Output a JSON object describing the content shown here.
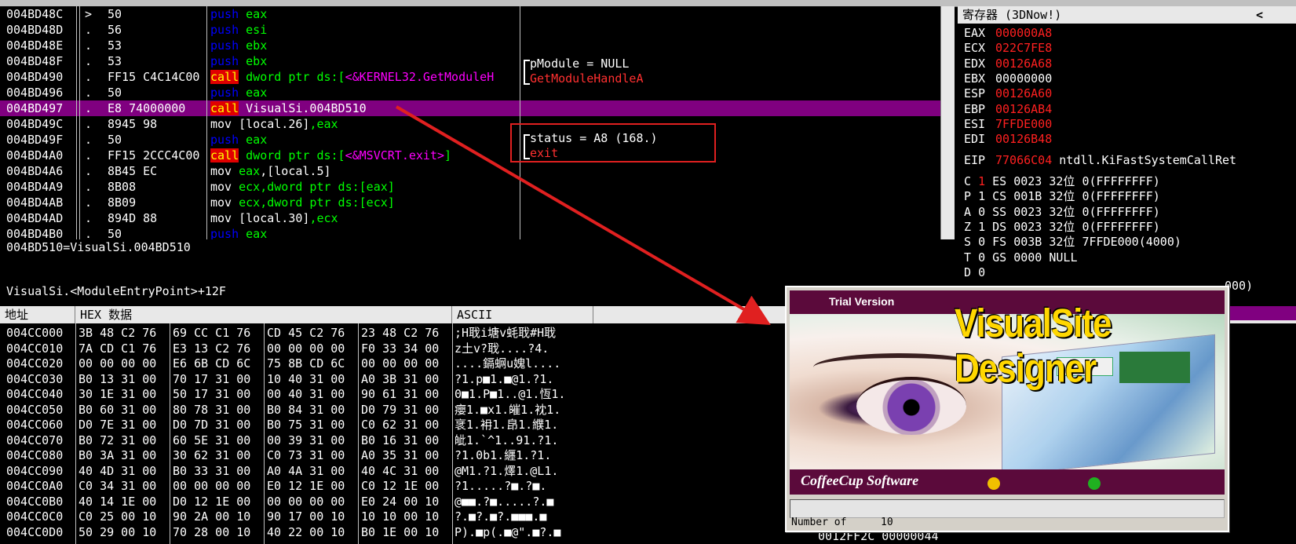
{
  "disasm": {
    "rows": [
      {
        "addr": "004BD48C",
        "mark": ">",
        "hex": "50",
        "kw": "push",
        "kwtype": "push",
        "ops": [
          {
            "t": "eax",
            "c": "reg2"
          }
        ]
      },
      {
        "addr": "004BD48D",
        "mark": ".",
        "hex": "56",
        "kw": "push",
        "kwtype": "push",
        "ops": [
          {
            "t": "esi",
            "c": "reg2"
          }
        ]
      },
      {
        "addr": "004BD48E",
        "mark": ".",
        "hex": "53",
        "kw": "push",
        "kwtype": "push",
        "ops": [
          {
            "t": "ebx",
            "c": "reg2"
          }
        ]
      },
      {
        "addr": "004BD48F",
        "mark": ".",
        "hex": "53",
        "kw": "push",
        "kwtype": "push",
        "ops": [
          {
            "t": "ebx",
            "c": "reg2"
          }
        ]
      },
      {
        "addr": "004BD490",
        "mark": ".",
        "hex": "FF15 C4C14C00",
        "kw": "call",
        "kwtype": "call",
        "ops": [
          {
            "t": " dword ptr ds:[",
            "c": "mem"
          },
          {
            "t": "<&KERNEL32.GetModuleH",
            "c": "api"
          }
        ]
      },
      {
        "addr": "004BD496",
        "mark": ".",
        "hex": "50",
        "kw": "push",
        "kwtype": "push",
        "ops": [
          {
            "t": "eax",
            "c": "reg2"
          }
        ]
      },
      {
        "addr": "004BD497",
        "mark": ".",
        "hex": "E8 74000000",
        "kw": "call",
        "kwtype": "call",
        "ops": [
          {
            "t": " VisualSi.004BD510",
            "c": "lbl"
          }
        ],
        "selected": true
      },
      {
        "addr": "004BD49C",
        "mark": ".",
        "hex": "8945 98",
        "kw": "mov",
        "kwtype": "mov",
        "ops": [
          {
            "t": " [local.26]",
            "c": "lbl"
          },
          {
            "t": ",eax",
            "c": "reg2"
          }
        ]
      },
      {
        "addr": "004BD49F",
        "mark": ".",
        "hex": "50",
        "kw": "push",
        "kwtype": "push",
        "ops": [
          {
            "t": "eax",
            "c": "reg2"
          }
        ]
      },
      {
        "addr": "004BD4A0",
        "mark": ".",
        "hex": "FF15 2CCC4C00",
        "kw": "call",
        "kwtype": "call",
        "ops": [
          {
            "t": " dword ptr ds:[",
            "c": "mem"
          },
          {
            "t": "<&MSVCRT.exit>",
            "c": "api"
          },
          {
            "t": "]",
            "c": "mem"
          }
        ]
      },
      {
        "addr": "004BD4A6",
        "mark": ".",
        "hex": "8B45 EC",
        "kw": "mov",
        "kwtype": "mov",
        "ops": [
          {
            "t": " eax",
            "c": "reg2"
          },
          {
            "t": ",[local.5]",
            "c": "lbl"
          }
        ]
      },
      {
        "addr": "004BD4A9",
        "mark": ".",
        "hex": "8B08",
        "kw": "mov",
        "kwtype": "mov",
        "ops": [
          {
            "t": " ecx",
            "c": "reg2"
          },
          {
            "t": ",dword ptr ds:[eax]",
            "c": "mem"
          }
        ]
      },
      {
        "addr": "004BD4AB",
        "mark": ".",
        "hex": "8B09",
        "kw": "mov",
        "kwtype": "mov",
        "ops": [
          {
            "t": " ecx",
            "c": "reg2"
          },
          {
            "t": ",dword ptr ds:[ecx]",
            "c": "mem"
          }
        ]
      },
      {
        "addr": "004BD4AD",
        "mark": ".",
        "hex": "894D 88",
        "kw": "mov",
        "kwtype": "mov",
        "ops": [
          {
            "t": " [local.30]",
            "c": "lbl"
          },
          {
            "t": ",ecx",
            "c": "reg2"
          }
        ]
      },
      {
        "addr": "004BD4B0",
        "mark": ".",
        "hex": "50",
        "kw": "push",
        "kwtype": "push",
        "ops": [
          {
            "t": "eax",
            "c": "reg2"
          }
        ]
      }
    ],
    "comments": {
      "pmodule": "pModule = NULL",
      "getmodule": "GetModuleHandleA",
      "status": "status = A8 (168.)",
      "exit": "exit"
    }
  },
  "info": {
    "line1": "004BD510=VisualSi.004BD510",
    "line2": "VisualSi.<ModuleEntryPoint>+12F"
  },
  "registers": {
    "title": "寄存器 (3DNow!)",
    "collapse": "<",
    "items": [
      {
        "name": "EAX",
        "value": "000000A8",
        "red": true
      },
      {
        "name": "ECX",
        "value": "022C7FE8",
        "red": true
      },
      {
        "name": "EDX",
        "value": "00126A68",
        "red": true
      },
      {
        "name": "EBX",
        "value": "00000000",
        "red": false
      },
      {
        "name": "ESP",
        "value": "00126A60",
        "red": true
      },
      {
        "name": "EBP",
        "value": "00126AB4",
        "red": true
      },
      {
        "name": "ESI",
        "value": "7FFDE000",
        "red": true
      },
      {
        "name": "EDI",
        "value": "00126B48",
        "red": true
      }
    ],
    "eip": {
      "name": "EIP",
      "value": "77066C04",
      "sym": "ntdll.KiFastSystemCallRet"
    },
    "flags": [
      {
        "f": "C",
        "v": "1",
        "vred": true,
        "seg": "ES 0023 32位 0(FFFFFFFF)"
      },
      {
        "f": "P",
        "v": "1",
        "vred": false,
        "seg": "CS 001B 32位 0(FFFFFFFF)"
      },
      {
        "f": "A",
        "v": "0",
        "vred": false,
        "seg": "SS 0023 32位 0(FFFFFFFF)"
      },
      {
        "f": "Z",
        "v": "1",
        "vred": false,
        "seg": "DS 0023 32位 0(FFFFFFFF)"
      },
      {
        "f": "S",
        "v": "0",
        "vred": false,
        "seg": "FS 003B 32位 7FFDE000(4000)"
      },
      {
        "f": "T",
        "v": "0",
        "vred": false,
        "seg": "GS 0000 NULL"
      },
      {
        "f": "D",
        "v": "0",
        "vred": false,
        "seg": ""
      }
    ],
    "tail": "000)"
  },
  "dump": {
    "headers": {
      "addr": "地址",
      "hex": "HEX 数据",
      "ascii": "ASCII"
    },
    "rows": [
      {
        "a": "004CC000",
        "g": [
          "3B 48 C2 76",
          "69 CC C1 76",
          "CD 45 C2 76",
          "23 48 C2 76"
        ],
        "s": ";H聀i塘v蚝聀#H聀"
      },
      {
        "a": "004CC010",
        "g": [
          "7A CD C1 76",
          "E3 13 C2 76",
          "00 00 00 00",
          "F0 33 34 00"
        ],
        "s": "z土v?聀....?4."
      },
      {
        "a": "004CC020",
        "g": [
          "00 00 00 00",
          "E6 6B CD 6C",
          "75 8B CD 6C",
          "00 00 00 00"
        ],
        "s": "....鎘蛧u媿l...."
      },
      {
        "a": "004CC030",
        "g": [
          "B0 13 31 00",
          "70 17 31 00",
          "10 40 31 00",
          "A0 3B 31 00"
        ],
        "s": "?1.p■1.■@1.?1."
      },
      {
        "a": "004CC040",
        "g": [
          "30 1E 31 00",
          "50 17 31 00",
          "00 40 31 00",
          "90 61 31 00"
        ],
        "s": "0■1.P■1..@1.恆1."
      },
      {
        "a": "004CC050",
        "g": [
          "B0 60 31 00",
          "80 78 31 00",
          "B0 84 31 00",
          "D0 79 31 00"
        ],
        "s": "癭1.■x1.皠1.衴1."
      },
      {
        "a": "004CC060",
        "g": [
          "D0 7E 31 00",
          "D0 7D 31 00",
          "B0 75 31 00",
          "C0 62 31 00"
        ],
        "s": "衺1.衻1.皍1.纀1."
      },
      {
        "a": "004CC070",
        "g": [
          "B0 72 31 00",
          "60 5E 31 00",
          "00 39 31 00",
          "B0 16 31 00"
        ],
        "s": "皉1.`^1..91.?1."
      },
      {
        "a": "004CC080",
        "g": [
          "B0 3A 31 00",
          "30 62 31 00",
          "C0 73 31 00",
          "A0 35 31 00"
        ],
        "s": "?1.0b1.纒1.?1."
      },
      {
        "a": "004CC090",
        "g": [
          "40 4D 31 00",
          "B0 33 31 00",
          "A0 4A 31 00",
          "40 4C 31 00"
        ],
        "s": "@M1.?1.燡1.@L1."
      },
      {
        "a": "004CC0A0",
        "g": [
          "C0 34 31 00",
          "00 00 00 00",
          "E0 12 1E 00",
          "C0 12 1E 00"
        ],
        "s": "?1.....?■.?■."
      },
      {
        "a": "004CC0B0",
        "g": [
          "40 14 1E 00",
          "D0 12 1E 00",
          "00 00 00 00",
          "E0 24 00 10"
        ],
        "s": "@■■.?■.....?.■"
      },
      {
        "a": "004CC0C0",
        "g": [
          "C0 25 00 10",
          "90 2A 00 10",
          "90 17 00 10",
          "10 10 00 10"
        ],
        "s": "?.■?.■?.■■■.■"
      },
      {
        "a": "004CC0D0",
        "g": [
          "50 29 00 10",
          "70 28 00 10",
          "40 22 00 10",
          "B0 1E 00 10"
        ],
        "s": "P).■p(.■@\".■?.■"
      }
    ]
  },
  "bottom": {
    "text": "0012FF2C  00000044"
  },
  "splash": {
    "trial": "Trial Version",
    "logo": "VisualSite Designer",
    "company": "CoffeeCup Software",
    "status_label": "Number of",
    "status_value": "10"
  }
}
